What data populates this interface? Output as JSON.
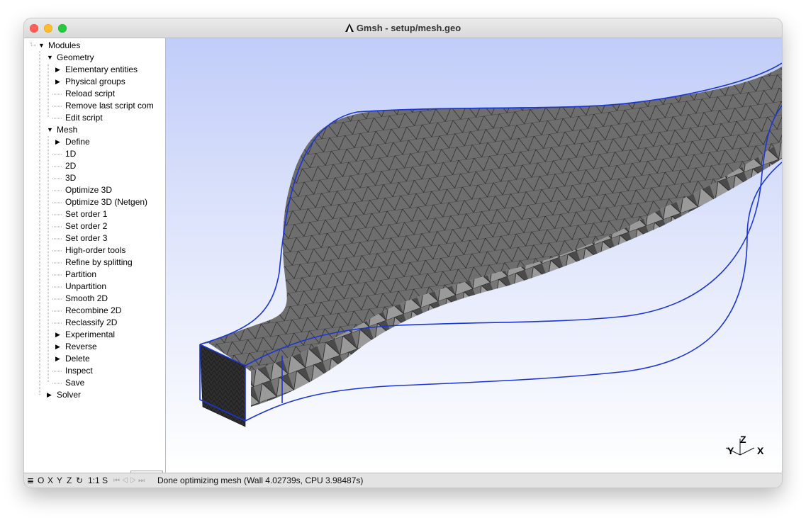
{
  "window": {
    "title": "Gmsh - setup/mesh.geo"
  },
  "tree": {
    "modules": "Modules",
    "geometry": {
      "label": "Geometry",
      "items": [
        "Elementary entities",
        "Physical groups",
        "Reload script",
        "Remove last script com",
        "Edit script"
      ]
    },
    "mesh": {
      "label": "Mesh",
      "items": [
        "Define",
        "1D",
        "2D",
        "3D",
        "Optimize 3D",
        "Optimize 3D (Netgen)",
        "Set order 1",
        "Set order 2",
        "Set order 3",
        "High-order tools",
        "Refine by splitting",
        "Partition",
        "Unpartition",
        "Smooth 2D",
        "Recombine 2D",
        "Reclassify 2D",
        "Experimental",
        "Reverse",
        "Delete",
        "Inspect",
        "Save"
      ]
    },
    "solver": "Solver"
  },
  "settings_button": {
    "icon": "gear-icon",
    "arrow": "▽"
  },
  "axes": {
    "z": "Z",
    "y": "Y",
    "x": "X"
  },
  "status": {
    "menu_icon": "≣",
    "o": "O",
    "x": "X",
    "y": "Y",
    "z": "Z",
    "rotate_icon": "↻",
    "scale": "1:1",
    "s": "S",
    "play_controls": "⏮ ◁ ▷ ⏭",
    "message": "Done optimizing mesh (Wall 4.02739s, CPU 3.98487s)"
  },
  "colors": {
    "boundary_blue": "#1a35d6",
    "mesh_gray": "#6b6b6b",
    "bg_top": "#c1cdf9"
  }
}
